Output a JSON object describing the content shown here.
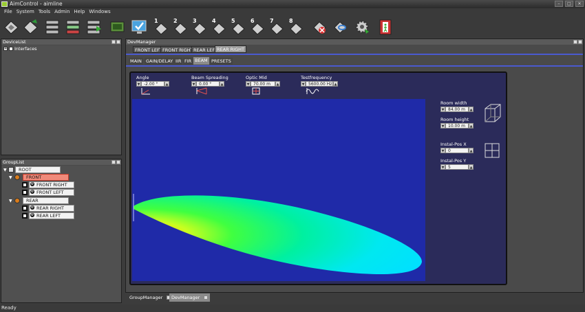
{
  "window": {
    "title": "AimControl - aimline"
  },
  "menubar": [
    "File",
    "System",
    "Tools",
    "Admin",
    "Help",
    "Windows"
  ],
  "toolbar": {
    "numbers": [
      "1",
      "2",
      "3",
      "4",
      "5",
      "6",
      "7",
      "8"
    ]
  },
  "device_list": {
    "title": "DeviceList",
    "root": "Interfaces"
  },
  "group_list": {
    "title": "GroupList",
    "root": "ROOT",
    "groups": [
      {
        "name": "FRONT",
        "children": [
          "FRONT RIGHT",
          "FRONT LEFT"
        ]
      },
      {
        "name": "REAR",
        "children": [
          "REAR RIGHT",
          "REAR LEFT"
        ]
      }
    ]
  },
  "dev_manager": {
    "title": "DevManager",
    "device_tabs": [
      "FRONT LEFT",
      "FRONT RIGHT",
      "REAR LEFT",
      "REAR RIGHT"
    ],
    "active_device_tab": "REAR RIGHT",
    "sub_tabs": [
      "MAIN",
      "GAIN/DELAY",
      "IIR",
      "FIR",
      "BEAM",
      "PRESETS"
    ],
    "active_sub_tab": "BEAM",
    "beam": {
      "angle": {
        "label": "Angle",
        "value": "-2.00 °"
      },
      "spreading": {
        "label": "Beam Spreading",
        "value": "0.00 °"
      },
      "optic_mid": {
        "label": "Optic Mid",
        "value": "70.00 m"
      },
      "testfreq": {
        "label": "Testfrequency",
        "value": "5600.00 Hz"
      },
      "room_width": {
        "label": "Room width",
        "value": "84.00 m"
      },
      "room_height": {
        "label": "Room height",
        "value": "10.00 m"
      },
      "instal_x": {
        "label": "Instal-Pos X",
        "value": "0"
      },
      "instal_y": {
        "label": "Instal-Pos Y",
        "value": "5"
      }
    }
  },
  "bottom_tabs": [
    "GroupManager",
    "DevManager"
  ],
  "active_bottom_tab": "DevManager",
  "status": "Ready",
  "colors": {
    "beam_bg": "#1f2aa8",
    "panel_bg": "#2b2b5a",
    "accent": "#f08a7a"
  }
}
